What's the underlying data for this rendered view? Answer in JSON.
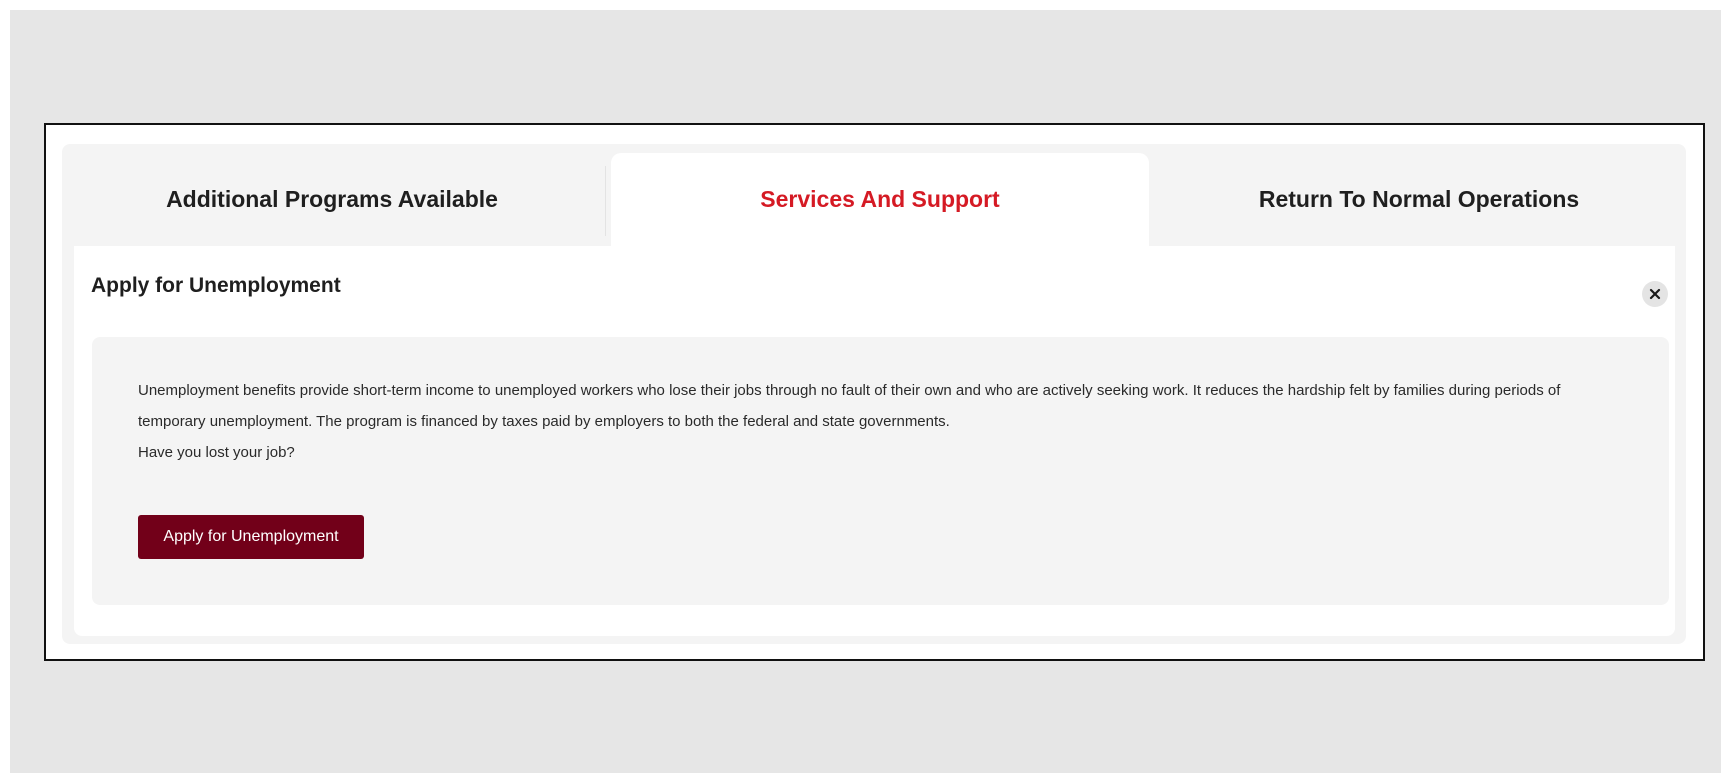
{
  "tabs": [
    {
      "label": "Additional Programs Available",
      "active": false
    },
    {
      "label": "Services And Support",
      "active": true
    },
    {
      "label": "Return To Normal Operations",
      "active": false
    }
  ],
  "section": {
    "title": "Apply for Unemployment",
    "close_icon": "close-icon",
    "description": "Unemployment benefits provide short-term income to unemployed workers who lose their jobs through no fault of their own and who are actively seeking work. It reduces the hardship felt by families during periods of temporary unemployment. The program is financed by taxes paid by employers to both the federal and state governments.",
    "question": "Have you lost your job?",
    "button_label": "Apply for Unemployment"
  },
  "colors": {
    "active_tab_text": "#d51a24",
    "button_bg": "#720019",
    "page_background": "#e6e6e6",
    "panel_background": "#f4f4f4"
  }
}
